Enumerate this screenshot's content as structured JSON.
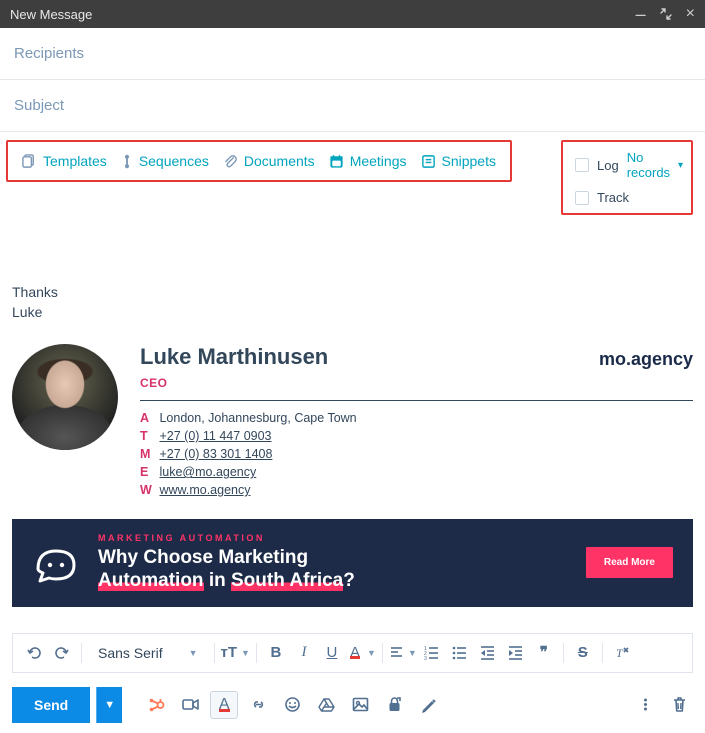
{
  "window": {
    "title": "New Message"
  },
  "fields": {
    "recipients_placeholder": "Recipients",
    "subject_placeholder": "Subject"
  },
  "toolbar": {
    "templates": "Templates",
    "sequences": "Sequences",
    "documents": "Documents",
    "meetings": "Meetings",
    "snippets": "Snippets"
  },
  "tracking": {
    "log_label": "Log",
    "no_records": "No records",
    "track_label": "Track"
  },
  "body": {
    "thanks": "Thanks",
    "name": "Luke"
  },
  "signature": {
    "full_name": "Luke Marthinusen",
    "job_title": "CEO",
    "brand": "mo.agency",
    "address_label": "A",
    "address": "London, Johannesburg, Cape Town",
    "tel_label": "T",
    "tel": "+27 (0) 11 447 0903",
    "mobile_label": "M",
    "mobile": "+27 (0) 83 301 1408",
    "email_label": "E",
    "email": "luke@mo.agency",
    "web_label": "W",
    "web": "www.mo.agency"
  },
  "banner": {
    "eyebrow": "Marketing Automation",
    "headline_part1": "Why Choose Marketing ",
    "headline_part2": "Automation",
    "headline_part3": " in ",
    "headline_part4": "South Africa",
    "headline_part5": "?",
    "cta": "Read More"
  },
  "format": {
    "font_family": "Sans Serif"
  },
  "actions": {
    "send": "Send"
  }
}
